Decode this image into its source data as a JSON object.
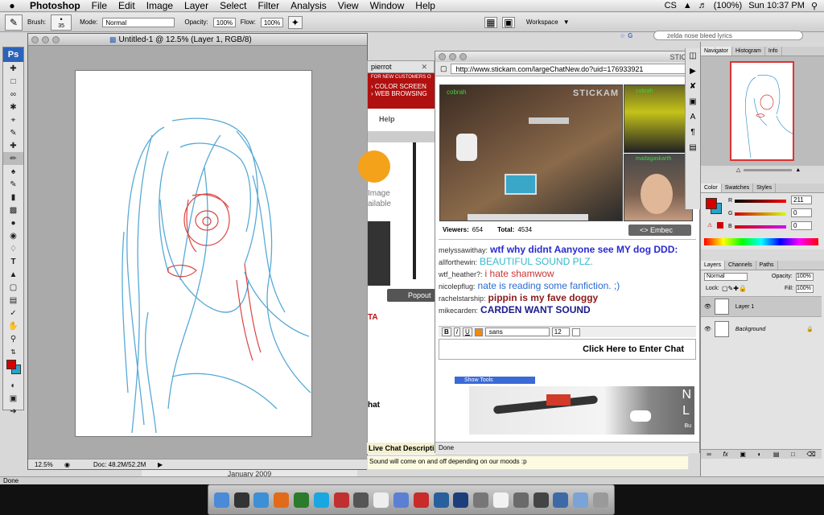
{
  "menubar": {
    "apple": "",
    "app": "Photoshop",
    "items": [
      "File",
      "Edit",
      "Image",
      "Layer",
      "Select",
      "Filter",
      "Analysis",
      "View",
      "Window",
      "Help"
    ],
    "clock": "Sun 10:37 PM",
    "battery": "(100%)",
    "cs": "CS"
  },
  "options": {
    "brush_label": "Brush:",
    "brush_size": "35",
    "mode_label": "Mode:",
    "mode_value": "Normal",
    "opacity_label": "Opacity:",
    "opacity_value": "100%",
    "flow_label": "Flow:",
    "flow_value": "100%",
    "workspace": "Workspace"
  },
  "toolbox": {
    "badge": "Ps"
  },
  "document": {
    "title": "Untitled-1 @ 12.5% (Layer 1, RGB/8)",
    "zoom": "12.5%",
    "doc_info": "Doc: 48.2M/52.2M",
    "calendar": "January 2009"
  },
  "browser_back": {
    "tab": "pierrot",
    "promo1": "› COLOR SCREEN",
    "promo2": "› WEB BROWSING",
    "help": "Help",
    "image_text": "Image",
    "available": "ailable",
    "popout": "Popout",
    "ta": "TA",
    "hat": "hat",
    "live_chat_desc": "Live Chat Description",
    "desc_text": "Sound will come on and off depending on our moods :p",
    "done": "Done",
    "top_note": "FOR NEW CUSTOMERS O"
  },
  "stickam": {
    "title": "STICKA",
    "url": "http://www.stickam.com/largeChatNew.do?uid=176933921",
    "logo": "STICKAM",
    "cams": [
      {
        "user": "cobrah"
      },
      {
        "user": "cobrah"
      },
      {
        "user": "madagaskarth"
      }
    ],
    "viewers_label": "Viewers:",
    "viewers": "654",
    "total_label": "Total:",
    "total": "4534",
    "embed": "<> Embec",
    "font": "sans",
    "font_size": "12",
    "enter_chat": "Click Here to Enter Chat",
    "show_tools": "Show Tools",
    "ad_letters": [
      "N",
      "L"
    ],
    "ad_small": "Bu",
    "done": "Done"
  },
  "chat": [
    {
      "user": "melyssawithay:",
      "msg": "wtf why didnt Aanyone see MY dog DDD:",
      "color": "#2a2ad0",
      "bold": true
    },
    {
      "user": "allforthewin:",
      "msg": "BEAUTIFUL SOUND PLZ.",
      "color": "#33bbcc",
      "bold": false
    },
    {
      "user": "wtf_heather?:",
      "msg": "i hate shamwow",
      "color": "#cc3333",
      "bold": false
    },
    {
      "user": "nicolepflug:",
      "msg": "nate is reading some fanfiction. ;)",
      "color": "#2a6ad0",
      "bold": false
    },
    {
      "user": "rachelstarship:",
      "msg": "pippin is my fave doggy",
      "color": "#8b1a1a",
      "bold": true
    },
    {
      "user": "mikecarden:",
      "msg": "CARDEN WANT SOUND",
      "color": "#1a1a8b",
      "bold": true
    }
  ],
  "search": {
    "value": "zelda nose bleed lyrics"
  },
  "panels": {
    "nav_tabs": [
      "Navigator",
      "Histogram",
      "Info"
    ],
    "color_tabs": [
      "Color",
      "Swatches",
      "Styles"
    ],
    "r": "211",
    "g": "0",
    "b": "0",
    "layer_tabs": [
      "Layers",
      "Channels",
      "Paths"
    ],
    "blend": "Normal",
    "opacity_label": "Opacity:",
    "opacity": "100%",
    "lock_label": "Lock:",
    "fill_label": "Fill:",
    "fill": "100%",
    "layers": [
      "Layer 1",
      "Background"
    ],
    "fg_color": "#d30000",
    "bg_color": "#29a3c9"
  },
  "status": {
    "done": "Done"
  },
  "dock": [
    {
      "name": "finder-icon",
      "color": "#4a8ad6"
    },
    {
      "name": "dashboard-icon",
      "color": "#333"
    },
    {
      "name": "safari-icon",
      "color": "#3d8fd6"
    },
    {
      "name": "firefox-icon",
      "color": "#e26a1b"
    },
    {
      "name": "adium-icon",
      "color": "#2c7a2c"
    },
    {
      "name": "skype-icon",
      "color": "#1aa6e0"
    },
    {
      "name": "ical-icon",
      "color": "#c03030"
    },
    {
      "name": "preview-icon",
      "color": "#555"
    },
    {
      "name": "textedit-icon",
      "color": "#eee"
    },
    {
      "name": "itunes-icon",
      "color": "#5b7fd3"
    },
    {
      "name": "cs-icon",
      "color": "#c92a2a"
    },
    {
      "name": "network-icon",
      "color": "#2a5f9e"
    },
    {
      "name": "photoshop-icon",
      "color": "#1c3f7c"
    },
    {
      "name": "script-icon",
      "color": "#777"
    },
    {
      "name": "cisco-icon",
      "color": "#f2f2f2"
    },
    {
      "name": "shield-icon",
      "color": "#6a6a6a"
    },
    {
      "name": "camera-icon",
      "color": "#444"
    },
    {
      "name": "preview2-icon",
      "color": "#3d6aa6"
    },
    {
      "name": "downloads-icon",
      "color": "#7aa3d6"
    },
    {
      "name": "trash-icon",
      "color": "#9a9a9a"
    }
  ]
}
